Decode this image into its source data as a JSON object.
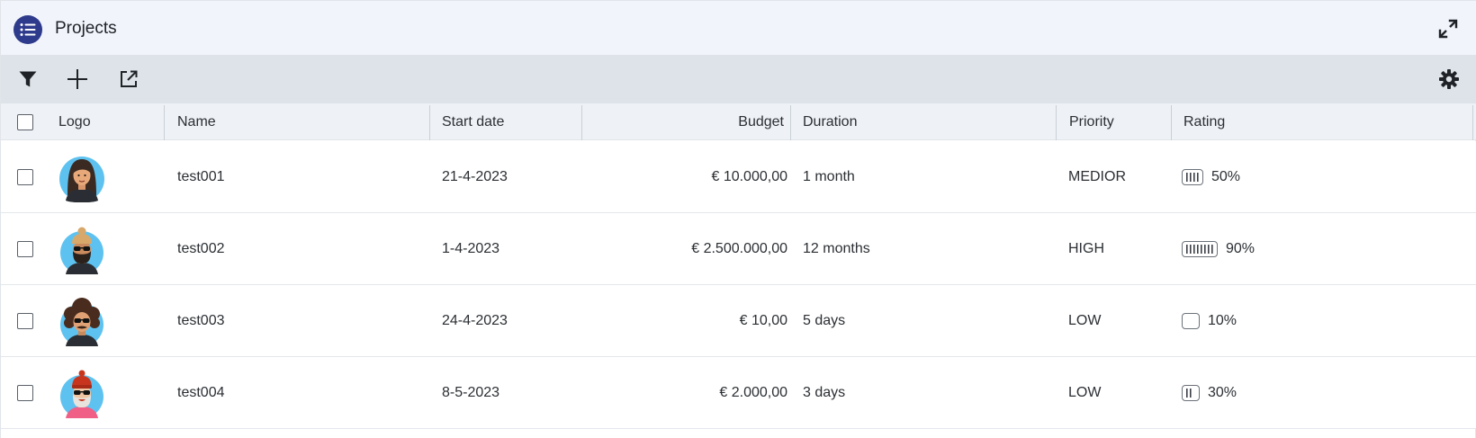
{
  "header": {
    "title": "Projects",
    "icons": {
      "app": "list-icon",
      "expand": "expand-icon"
    },
    "accent": "#2e3a8c"
  },
  "toolbar": {
    "icons": [
      "filter-icon",
      "plus-icon",
      "external-link-icon",
      "gear-icon"
    ]
  },
  "table": {
    "columns": {
      "logo": "Logo",
      "name": "Name",
      "start_date": "Start date",
      "budget": "Budget",
      "duration": "Duration",
      "priority": "Priority",
      "rating": "Rating"
    },
    "rows": [
      {
        "name": "test001",
        "start_date": "21-4-2023",
        "budget": "€ 10.000,00",
        "duration": "1 month",
        "priority": "MEDIOR",
        "rating": 0.5,
        "rating_label": "50%",
        "avatar": "avatar-woman-long-hair",
        "checked": false
      },
      {
        "name": "test002",
        "start_date": "1-4-2023",
        "budget": "€ 2.500.000,00",
        "duration": "12 months",
        "priority": "HIGH",
        "rating": 0.9,
        "rating_label": "90%",
        "avatar": "avatar-man-beard-sunglasses",
        "checked": false
      },
      {
        "name": "test003",
        "start_date": "24-4-2023",
        "budget": "€ 10,00",
        "duration": "5 days",
        "priority": "LOW",
        "rating": 0.1,
        "rating_label": "10%",
        "avatar": "avatar-man-curly-hair-sunglasses",
        "checked": false
      },
      {
        "name": "test004",
        "start_date": "8-5-2023",
        "budget": "€ 2.000,00",
        "duration": "3 days",
        "priority": "LOW",
        "rating": 0.3,
        "rating_label": "30%",
        "avatar": "avatar-man-red-beanie",
        "checked": false
      }
    ]
  }
}
